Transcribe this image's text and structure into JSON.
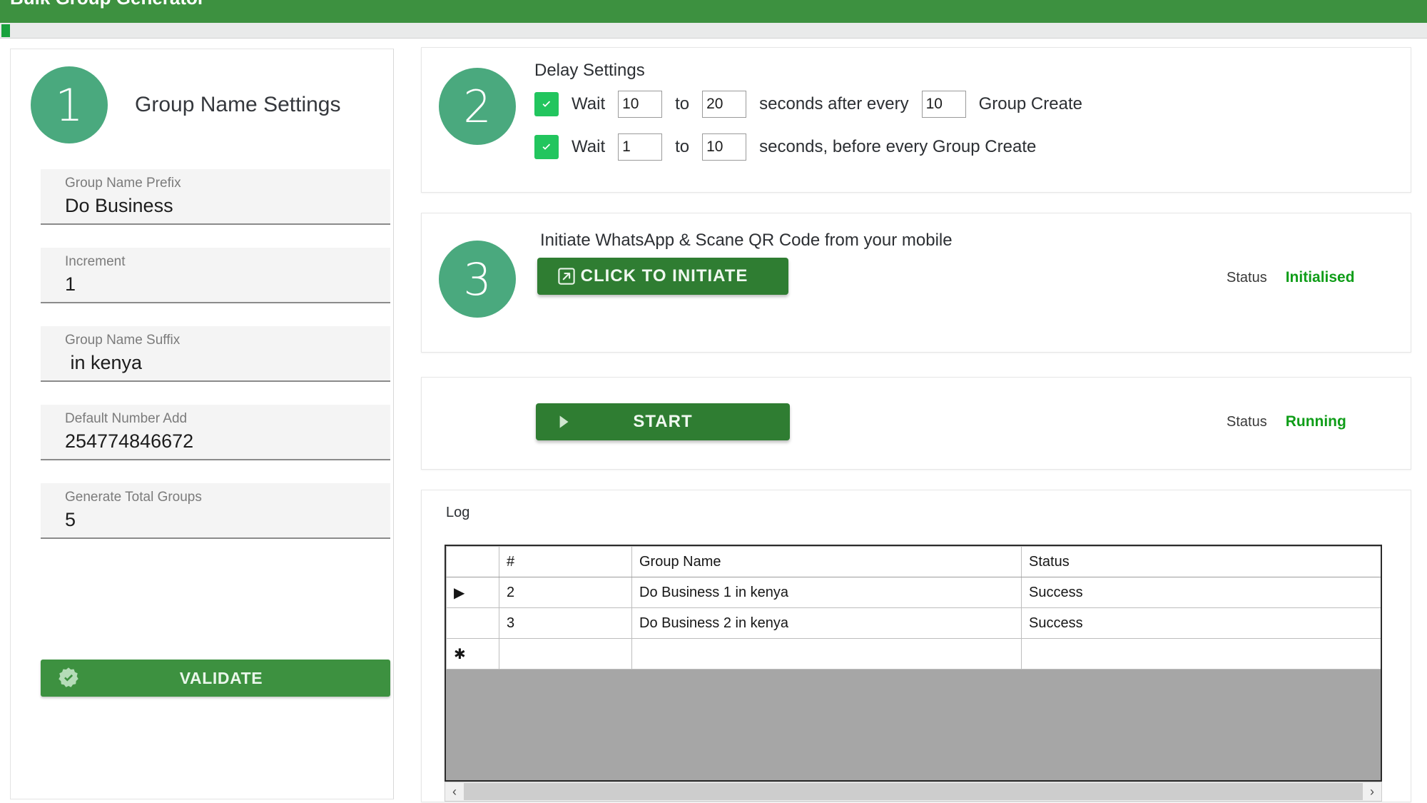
{
  "window": {
    "title": "Bulk Group Generator"
  },
  "step1": {
    "number": "1",
    "title": "Group Name Settings",
    "fields": [
      {
        "label": "Group Name Prefix",
        "value": "Do Business"
      },
      {
        "label": "Increment",
        "value": "1"
      },
      {
        "label": "Group Name Suffix",
        "value": " in kenya"
      },
      {
        "label": "Default Number Add",
        "value": "254774846672"
      },
      {
        "label": "Generate Total Groups",
        "value": "5"
      }
    ],
    "validate_label": "VALIDATE",
    "validate_icon": "seal-check-icon"
  },
  "step2": {
    "number": "2",
    "title": "Delay Settings",
    "row1": {
      "checked": true,
      "wait_label": "Wait",
      "min": "10",
      "to_label": "to",
      "max": "20",
      "mid_label": "seconds after every",
      "count": "10",
      "tail_label": "Group Create"
    },
    "row2": {
      "checked": true,
      "wait_label": "Wait",
      "min": "1",
      "to_label": "to",
      "max": "10",
      "tail_label": "seconds, before every Group Create"
    }
  },
  "step3": {
    "number": "3",
    "title": "Initiate WhatsApp & Scane QR Code from your mobile",
    "button_label": "CLICK TO INITIATE",
    "button_icon": "external-link-icon",
    "status_label": "Status",
    "status_value": "Initialised"
  },
  "start": {
    "button_label": "START",
    "button_icon": "play-icon",
    "status_label": "Status",
    "status_value": "Running"
  },
  "log": {
    "label": "Log",
    "columns": [
      "",
      "#",
      "Group Name",
      "Status"
    ],
    "rows": [
      {
        "indicator": "▶",
        "selected_num": true,
        "num": "2",
        "name": "Do Business 1 in kenya",
        "status": "Success"
      },
      {
        "indicator": "",
        "selected_num": false,
        "num": "3",
        "name": "Do Business 2 in kenya",
        "status": "Success"
      },
      {
        "indicator": "✱",
        "selected_num": false,
        "num": "",
        "name": "",
        "status": ""
      }
    ],
    "scroll_left": "‹",
    "scroll_right": "›"
  },
  "colors": {
    "brand_green": "#3d9140",
    "step_circle": "#4aa97e",
    "checkbox_green": "#22c55e",
    "status_green": "#0f9d18",
    "selection_blue": "#0078d7"
  }
}
